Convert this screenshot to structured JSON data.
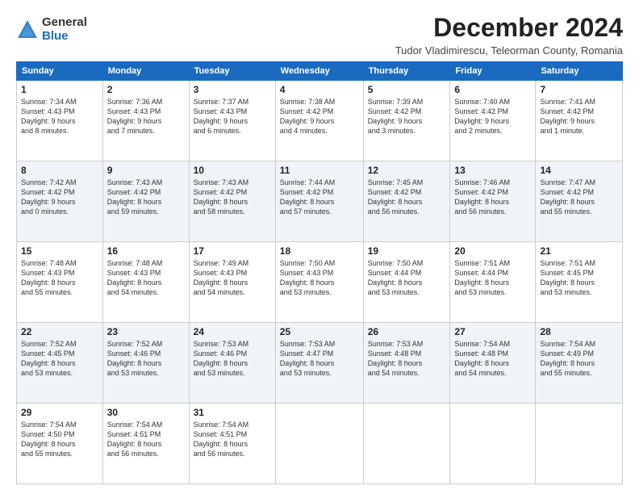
{
  "logo": {
    "general": "General",
    "blue": "Blue"
  },
  "title": "December 2024",
  "subtitle": "Tudor Vladimirescu, Teleorman County, Romania",
  "headers": [
    "Sunday",
    "Monday",
    "Tuesday",
    "Wednesday",
    "Thursday",
    "Friday",
    "Saturday"
  ],
  "weeks": [
    [
      {
        "day": "1",
        "info": "Sunrise: 7:34 AM\nSunset: 4:43 PM\nDaylight: 9 hours\nand 8 minutes."
      },
      {
        "day": "2",
        "info": "Sunrise: 7:36 AM\nSunset: 4:43 PM\nDaylight: 9 hours\nand 7 minutes."
      },
      {
        "day": "3",
        "info": "Sunrise: 7:37 AM\nSunset: 4:43 PM\nDaylight: 9 hours\nand 6 minutes."
      },
      {
        "day": "4",
        "info": "Sunrise: 7:38 AM\nSunset: 4:42 PM\nDaylight: 9 hours\nand 4 minutes."
      },
      {
        "day": "5",
        "info": "Sunrise: 7:39 AM\nSunset: 4:42 PM\nDaylight: 9 hours\nand 3 minutes."
      },
      {
        "day": "6",
        "info": "Sunrise: 7:40 AM\nSunset: 4:42 PM\nDaylight: 9 hours\nand 2 minutes."
      },
      {
        "day": "7",
        "info": "Sunrise: 7:41 AM\nSunset: 4:42 PM\nDaylight: 9 hours\nand 1 minute."
      }
    ],
    [
      {
        "day": "8",
        "info": "Sunrise: 7:42 AM\nSunset: 4:42 PM\nDaylight: 9 hours\nand 0 minutes."
      },
      {
        "day": "9",
        "info": "Sunrise: 7:43 AM\nSunset: 4:42 PM\nDaylight: 8 hours\nand 59 minutes."
      },
      {
        "day": "10",
        "info": "Sunrise: 7:43 AM\nSunset: 4:42 PM\nDaylight: 8 hours\nand 58 minutes."
      },
      {
        "day": "11",
        "info": "Sunrise: 7:44 AM\nSunset: 4:42 PM\nDaylight: 8 hours\nand 57 minutes."
      },
      {
        "day": "12",
        "info": "Sunrise: 7:45 AM\nSunset: 4:42 PM\nDaylight: 8 hours\nand 56 minutes."
      },
      {
        "day": "13",
        "info": "Sunrise: 7:46 AM\nSunset: 4:42 PM\nDaylight: 8 hours\nand 56 minutes."
      },
      {
        "day": "14",
        "info": "Sunrise: 7:47 AM\nSunset: 4:42 PM\nDaylight: 8 hours\nand 55 minutes."
      }
    ],
    [
      {
        "day": "15",
        "info": "Sunrise: 7:48 AM\nSunset: 4:43 PM\nDaylight: 8 hours\nand 55 minutes."
      },
      {
        "day": "16",
        "info": "Sunrise: 7:48 AM\nSunset: 4:43 PM\nDaylight: 8 hours\nand 54 minutes."
      },
      {
        "day": "17",
        "info": "Sunrise: 7:49 AM\nSunset: 4:43 PM\nDaylight: 8 hours\nand 54 minutes."
      },
      {
        "day": "18",
        "info": "Sunrise: 7:50 AM\nSunset: 4:43 PM\nDaylight: 8 hours\nand 53 minutes."
      },
      {
        "day": "19",
        "info": "Sunrise: 7:50 AM\nSunset: 4:44 PM\nDaylight: 8 hours\nand 53 minutes."
      },
      {
        "day": "20",
        "info": "Sunrise: 7:51 AM\nSunset: 4:44 PM\nDaylight: 8 hours\nand 53 minutes."
      },
      {
        "day": "21",
        "info": "Sunrise: 7:51 AM\nSunset: 4:45 PM\nDaylight: 8 hours\nand 53 minutes."
      }
    ],
    [
      {
        "day": "22",
        "info": "Sunrise: 7:52 AM\nSunset: 4:45 PM\nDaylight: 8 hours\nand 53 minutes."
      },
      {
        "day": "23",
        "info": "Sunrise: 7:52 AM\nSunset: 4:46 PM\nDaylight: 8 hours\nand 53 minutes."
      },
      {
        "day": "24",
        "info": "Sunrise: 7:53 AM\nSunset: 4:46 PM\nDaylight: 8 hours\nand 53 minutes."
      },
      {
        "day": "25",
        "info": "Sunrise: 7:53 AM\nSunset: 4:47 PM\nDaylight: 8 hours\nand 53 minutes."
      },
      {
        "day": "26",
        "info": "Sunrise: 7:53 AM\nSunset: 4:48 PM\nDaylight: 8 hours\nand 54 minutes."
      },
      {
        "day": "27",
        "info": "Sunrise: 7:54 AM\nSunset: 4:48 PM\nDaylight: 8 hours\nand 54 minutes."
      },
      {
        "day": "28",
        "info": "Sunrise: 7:54 AM\nSunset: 4:49 PM\nDaylight: 8 hours\nand 55 minutes."
      }
    ],
    [
      {
        "day": "29",
        "info": "Sunrise: 7:54 AM\nSunset: 4:50 PM\nDaylight: 8 hours\nand 55 minutes."
      },
      {
        "day": "30",
        "info": "Sunrise: 7:54 AM\nSunset: 4:51 PM\nDaylight: 8 hours\nand 56 minutes."
      },
      {
        "day": "31",
        "info": "Sunrise: 7:54 AM\nSunset: 4:51 PM\nDaylight: 8 hours\nand 56 minutes."
      },
      null,
      null,
      null,
      null
    ]
  ]
}
